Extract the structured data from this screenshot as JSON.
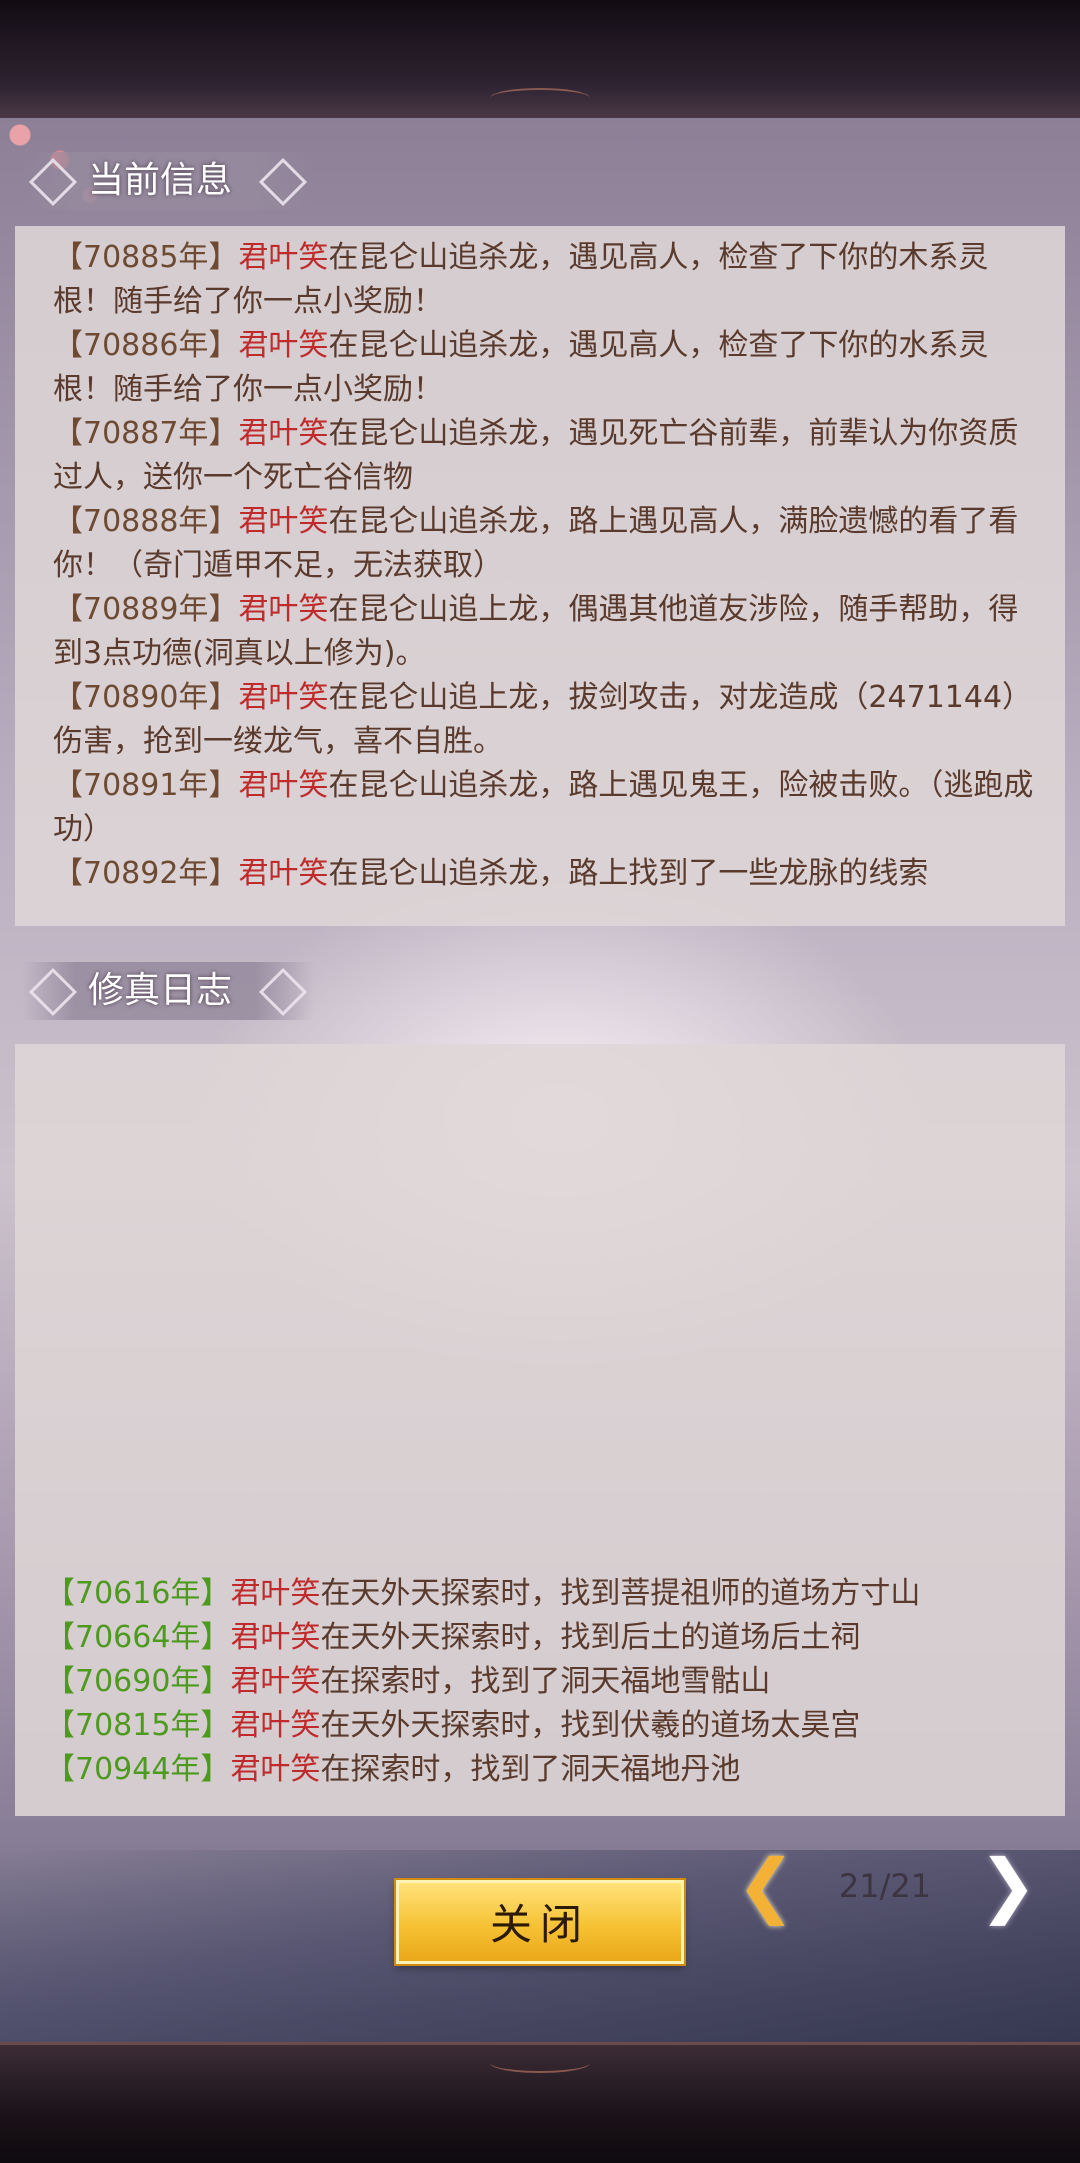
{
  "current_info": {
    "title": "当前信息",
    "entries": [
      {
        "year": "【70885年】",
        "name": "君叶笑",
        "text": "在昆仑山追杀龙，遇见高人，检查了下你的木系灵根！随手给了你一点小奖励！"
      },
      {
        "year": "【70886年】",
        "name": "君叶笑",
        "text": "在昆仑山追杀龙，遇见高人，检查了下你的水系灵根！随手给了你一点小奖励！"
      },
      {
        "year": "【70887年】",
        "name": "君叶笑",
        "text": "在昆仑山追杀龙，遇见死亡谷前辈，前辈认为你资质过人，送你一个死亡谷信物"
      },
      {
        "year": "【70888年】",
        "name": "君叶笑",
        "text": "在昆仑山追杀龙，路上遇见高人，满脸遗憾的看了看你！（奇门遁甲不足，无法获取）"
      },
      {
        "year": "【70889年】",
        "name": "君叶笑",
        "text": "在昆仑山追上龙，偶遇其他道友涉险，随手帮助，得到3点功德(洞真以上修为)。"
      },
      {
        "year": "【70890年】",
        "name": "君叶笑",
        "text": "在昆仑山追上龙，拔剑攻击，对龙造成（2471144）伤害，抢到一缕龙气，喜不自胜。"
      },
      {
        "year": "【70891年】",
        "name": "君叶笑",
        "text": "在昆仑山追杀龙，路上遇见鬼王，险被击败。（逃跑成功）"
      },
      {
        "year": "【70892年】",
        "name": "君叶笑",
        "text": "在昆仑山追杀龙，路上找到了一些龙脉的线索"
      }
    ]
  },
  "cultivation_log": {
    "title": "修真日志",
    "entries": [
      {
        "year": "【70616年】",
        "name": "君叶笑",
        "text": "在天外天探索时，找到菩提祖师的道场方寸山"
      },
      {
        "year": "【70664年】",
        "name": "君叶笑",
        "text": "在天外天探索时，找到后土的道场后土祠"
      },
      {
        "year": "【70690年】",
        "name": "君叶笑",
        "text": "在探索时，找到了洞天福地雪骷山"
      },
      {
        "year": "【70815年】",
        "name": "君叶笑",
        "text": "在天外天探索时，找到伏羲的道场太昊宫"
      },
      {
        "year": "【70944年】",
        "name": "君叶笑",
        "text": "在探索时，找到了洞天福地丹池"
      }
    ]
  },
  "footer": {
    "close_label": "关闭",
    "page_indicator": "21/21",
    "prev_glyph": "❮",
    "next_glyph": "❯"
  }
}
